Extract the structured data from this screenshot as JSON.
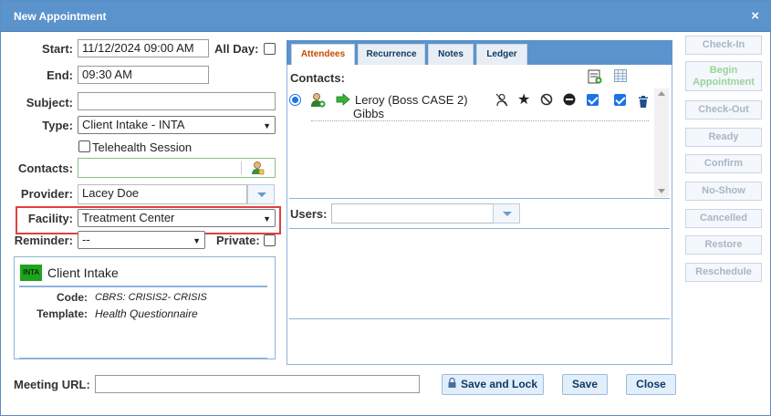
{
  "dialog": {
    "title": "New Appointment",
    "close_glyph": "×"
  },
  "form": {
    "start_label": "Start:",
    "start_value": "11/12/2024 09:00 AM",
    "all_day_label": "All Day:",
    "end_label": "End:",
    "end_value": "09:30 AM",
    "subject_label": "Subject:",
    "subject_value": "",
    "type_label": "Type:",
    "type_value": "Client Intake - INTA",
    "telehealth_label": "Telehealth Session",
    "contacts_label": "Contacts:",
    "contacts_value": "",
    "provider_label": "Provider:",
    "provider_value": "Lacey Doe",
    "facility_label": "Facility:",
    "facility_value": "Treatment Center",
    "reminder_label": "Reminder:",
    "reminder_value": "--",
    "private_label": "Private:"
  },
  "type_card": {
    "badge": "INTA",
    "title": "Client Intake",
    "code_label": "Code:",
    "code_value": "CBRS: CRISIS2- CRISIS",
    "template_label": "Template:",
    "template_value": "Health Questionnaire"
  },
  "tabs": [
    "Attendees",
    "Recurrence",
    "Notes",
    "Ledger"
  ],
  "attendees": {
    "contacts_label": "Contacts:",
    "contact_name": "Leroy (Boss CASE 2)",
    "contact_name_line2": "Gibbs",
    "users_label": "Users:"
  },
  "sidebar": {
    "check_in": "Check-In",
    "begin_1": "Begin",
    "begin_2": "Appointment",
    "check_out": "Check-Out",
    "ready": "Ready",
    "confirm": "Confirm",
    "no_show": "No-Show",
    "cancelled": "Cancelled",
    "restore": "Restore",
    "reschedule": "Reschedule"
  },
  "footer": {
    "meeting_url_label": "Meeting URL:",
    "meeting_url_value": "",
    "save_and_lock": "Save and Lock",
    "save": "Save",
    "close": "Close"
  },
  "colors": {
    "title_bar": "#5b93cc",
    "highlight": "#e04040",
    "active_tab": "#c54a00",
    "badge": "#1fa31f"
  }
}
